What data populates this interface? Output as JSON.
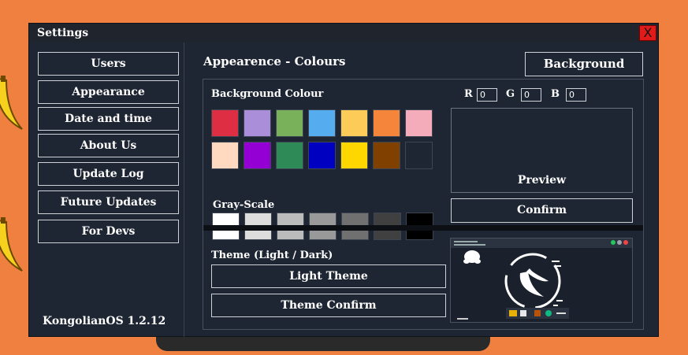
{
  "window": {
    "title": "Settings",
    "close_label": "X"
  },
  "sidebar": {
    "items": [
      {
        "label": "Users"
      },
      {
        "label": "Appearance"
      },
      {
        "label": "Date and time"
      },
      {
        "label": "About Us"
      },
      {
        "label": "Update Log"
      },
      {
        "label": "Future Updates"
      },
      {
        "label": "For Devs"
      }
    ],
    "version": "KongolianOS 1.2.12"
  },
  "main": {
    "section_title": "Appearence - Colours",
    "background_button": "Background",
    "background_colour_label": "Background Colour",
    "colour_swatches": [
      "#dd2e44",
      "#ab8ed9",
      "#78b159",
      "#55acee",
      "#fdcb58",
      "#f4853b",
      "#f4abba",
      "#ffdac0",
      "#9400d3",
      "#2e8b57",
      "#0000c0",
      "#ffd700",
      "#804000",
      "#1f2633"
    ],
    "grayscale_label": "Gray-Scale",
    "grayscale_swatches": [
      "#ffffff",
      "#dddddd",
      "#bbbbbb",
      "#999999",
      "#707070",
      "#404040",
      "#000000"
    ],
    "rgb": {
      "r_label": "R",
      "r_value": "0",
      "g_label": "G",
      "g_value": "0",
      "b_label": "B",
      "b_value": "0"
    },
    "preview_label": "Preview",
    "confirm_button": "Confirm",
    "theme_label": "Theme (Light / Dark)",
    "light_theme_button": "Light Theme",
    "theme_confirm_button": "Theme Confirm"
  }
}
